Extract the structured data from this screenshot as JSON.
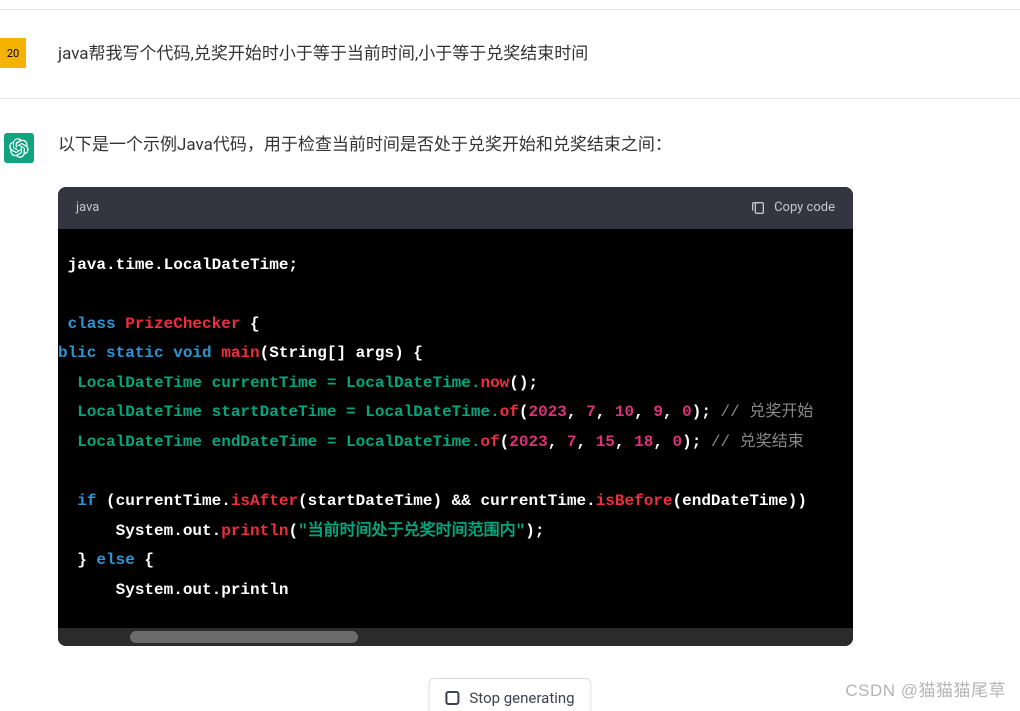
{
  "user": {
    "badge": "20",
    "message": "java帮我写个代码,兑奖开始时小于等于当前时间,小于等于兑奖结束时间"
  },
  "assistant": {
    "intro": "以下是一个示例Java代码，用于检查当前时间是否处于兑奖开始和兑奖结束之间：",
    "code_header": {
      "language": "java",
      "copy_label": "Copy code"
    },
    "code": {
      "l1": {
        "a": " java.time.LocalDateTime;"
      },
      "l2": {
        "a": " class ",
        "b": "PrizeChecker",
        "c": " {"
      },
      "l3": {
        "a": "blic",
        "b": " static",
        "c": " void",
        "d": " main",
        "e": "(String[] args)",
        "f": " {"
      },
      "l4": {
        "a": "  LocalDateTime currentTime = LocalDateTime.",
        "b": "now",
        "c": "();"
      },
      "l5": {
        "a": "  LocalDateTime startDateTime = LocalDateTime.",
        "b": "of",
        "c": "(",
        "n1": "2023",
        "s1": ", ",
        "n2": "7",
        "s2": ", ",
        "n3": "10",
        "s3": ", ",
        "n4": "9",
        "s4": ", ",
        "n5": "0",
        "d": "); ",
        "cm": "// 兑奖开始"
      },
      "l6": {
        "a": "  LocalDateTime endDateTime = LocalDateTime.",
        "b": "of",
        "c": "(",
        "n1": "2023",
        "s1": ", ",
        "n2": "7",
        "s2": ", ",
        "n3": "15",
        "s3": ", ",
        "n4": "18",
        "s4": ", ",
        "n5": "0",
        "d": "); ",
        "cm": "// 兑奖结束"
      },
      "l7": {
        "a": "  if",
        "b": " (currentTime.",
        "c": "isAfter",
        "d": "(startDateTime) && currentTime.",
        "e": "isBefore",
        "f": "(endDateTime))"
      },
      "l8": {
        "a": "      System.out.",
        "b": "println",
        "c": "(",
        "s": "\"当前时间处于兑奖时间范围内\"",
        "d": ");"
      },
      "l9": {
        "a": "  } ",
        "b": "else",
        "c": " {"
      },
      "l10": {
        "a": "      System.out.println"
      }
    }
  },
  "stop_label": "Stop generating",
  "watermark": "CSDN @猫猫猫尾草"
}
